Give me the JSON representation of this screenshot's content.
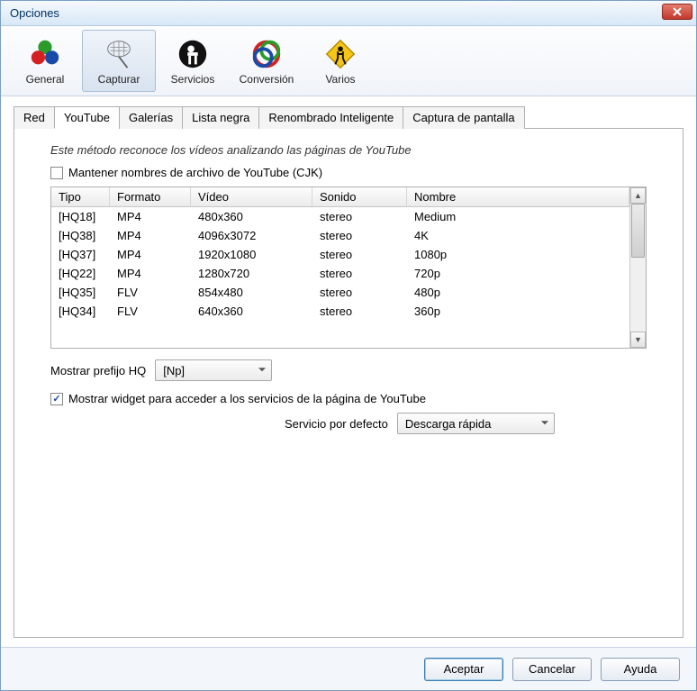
{
  "window": {
    "title": "Opciones"
  },
  "toolbar": {
    "items": [
      {
        "label": "General"
      },
      {
        "label": "Capturar"
      },
      {
        "label": "Servicios"
      },
      {
        "label": "Conversión"
      },
      {
        "label": "Varios"
      }
    ],
    "selected_index": 1
  },
  "tabs": {
    "items": [
      "Red",
      "YouTube",
      "Galerías",
      "Lista negra",
      "Renombrado Inteligente",
      "Captura de pantalla"
    ],
    "active_index": 1
  },
  "youtube": {
    "description": "Este método reconoce los vídeos analizando las páginas de YouTube",
    "keep_names_label": "Mantener nombres de archivo de YouTube (CJK)",
    "keep_names_checked": false,
    "columns": [
      "Tipo",
      "Formato",
      "Vídeo",
      "Sonido",
      "Nombre"
    ],
    "rows": [
      {
        "tipo": "[HQ18]",
        "formato": "MP4",
        "video": "480x360",
        "sonido": "stereo",
        "nombre": "Medium"
      },
      {
        "tipo": "[HQ38]",
        "formato": "MP4",
        "video": "4096x3072",
        "sonido": "stereo",
        "nombre": "4K"
      },
      {
        "tipo": "[HQ37]",
        "formato": "MP4",
        "video": "1920x1080",
        "sonido": "stereo",
        "nombre": "1080p"
      },
      {
        "tipo": "[HQ22]",
        "formato": "MP4",
        "video": "1280x720",
        "sonido": "stereo",
        "nombre": "720p"
      },
      {
        "tipo": "[HQ35]",
        "formato": "FLV",
        "video": "854x480",
        "sonido": "stereo",
        "nombre": "480p"
      },
      {
        "tipo": "[HQ34]",
        "formato": "FLV",
        "video": "640x360",
        "sonido": "stereo",
        "nombre": "360p"
      }
    ],
    "prefix_label": "Mostrar prefijo HQ",
    "prefix_value": "[Np]",
    "widget_label": "Mostrar widget para acceder a los servicios de la página de YouTube",
    "widget_checked": true,
    "service_label": "Servicio por defecto",
    "service_value": "Descarga rápida"
  },
  "buttons": {
    "accept": "Aceptar",
    "cancel": "Cancelar",
    "help": "Ayuda"
  }
}
